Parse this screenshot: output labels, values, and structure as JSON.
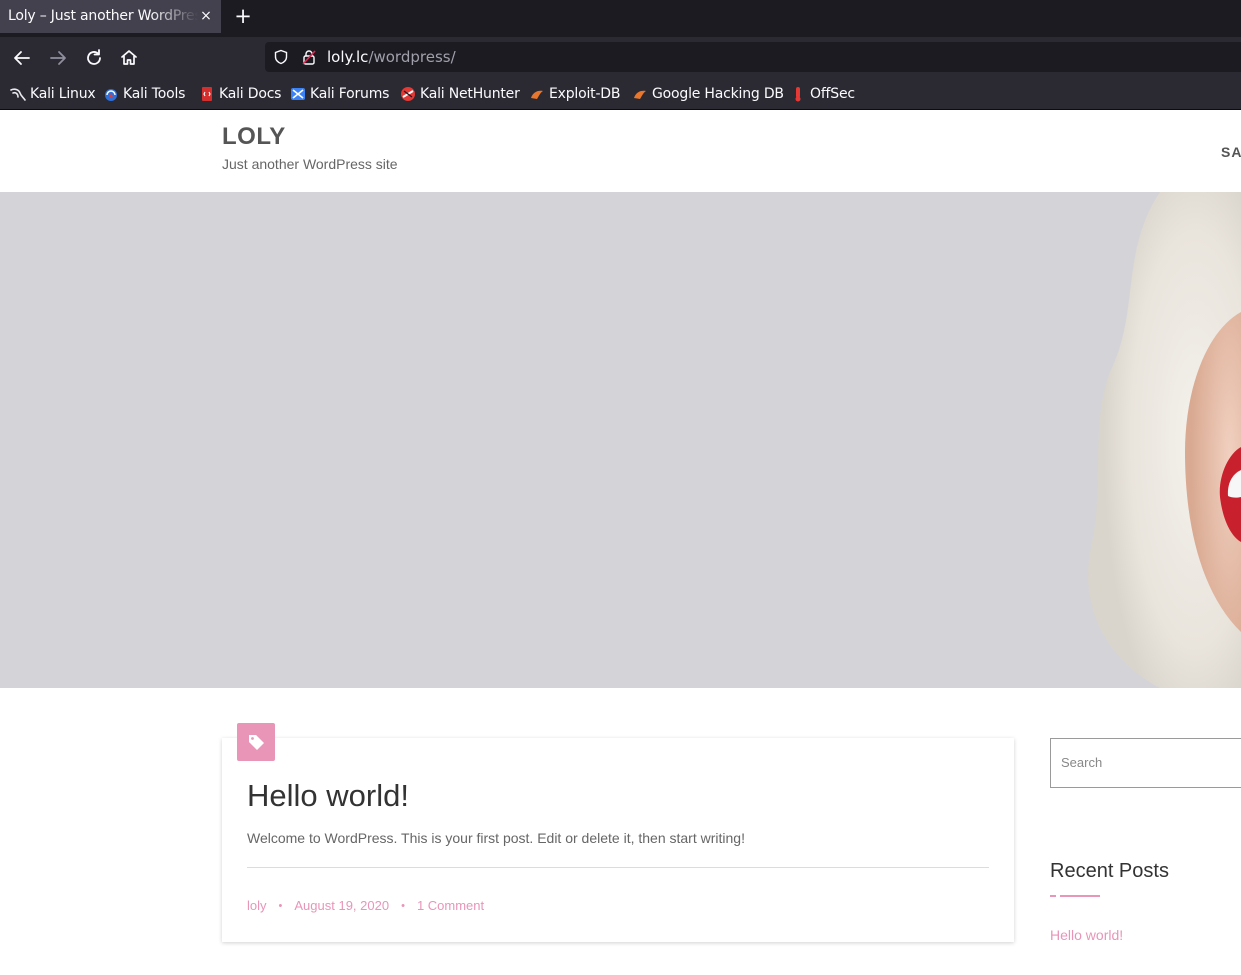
{
  "browser": {
    "tab_title": "Loly – Just another WordPress site",
    "tab_close_glyph": "×",
    "new_tab_glyph": "+",
    "url_host": "loly.lc",
    "url_path": "/wordpress/",
    "bookmarks": [
      {
        "label": "Kali Linux",
        "icon": "kali-dragon-icon"
      },
      {
        "label": "Kali Tools",
        "icon": "kali-tools-icon"
      },
      {
        "label": "Kali Docs",
        "icon": "kali-docs-icon"
      },
      {
        "label": "Kali Forums",
        "icon": "kali-forums-icon"
      },
      {
        "label": "Kali NetHunter",
        "icon": "nethunter-icon"
      },
      {
        "label": "Exploit-DB",
        "icon": "exploit-db-icon"
      },
      {
        "label": "Google Hacking DB",
        "icon": "ghdb-icon"
      },
      {
        "label": "OffSec",
        "icon": "offsec-icon"
      }
    ]
  },
  "site": {
    "title": "LOLY",
    "description": "Just another WordPress site",
    "menu_item": "SA"
  },
  "post": {
    "title": "Hello world!",
    "excerpt": "Welcome to WordPress. This is your first post. Edit or delete it, then start writing!",
    "author": "loly",
    "date": "August 19, 2020",
    "comments": "1 Comment",
    "separator": "•"
  },
  "sidebar": {
    "search_placeholder": "Search",
    "recent_posts_title": "Recent Posts",
    "recent_posts": [
      "Hello world!"
    ]
  },
  "colors": {
    "accent": "#e895b8",
    "hero_bg": "#d4d4d8",
    "chrome_dark": "#1c1b22",
    "chrome": "#2b2a33"
  }
}
